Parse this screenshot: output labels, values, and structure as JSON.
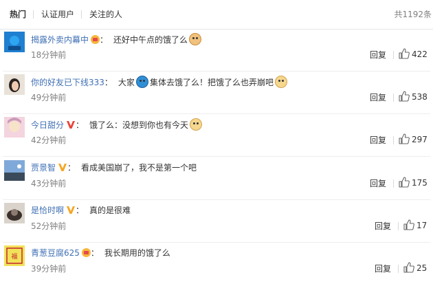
{
  "tabs": [
    {
      "label": "热门",
      "active": true
    },
    {
      "label": "认证用户",
      "active": false
    },
    {
      "label": "关注的人",
      "active": false
    }
  ],
  "total": "共1192条",
  "colors": {
    "username": "#3f6fb5",
    "secondary": "#808080",
    "vip": "#f7b63b"
  },
  "comments": [
    {
      "user": "揭露外卖内幕中",
      "badge": "crown",
      "parts": [
        {
          "t": "还好中午点的饿了么"
        },
        {
          "emoji": "cat-icon"
        }
      ],
      "time": "18分钟前",
      "reply": "回复",
      "likes": "422"
    },
    {
      "user": "你的好友已下线333",
      "badge": "",
      "parts": [
        {
          "t": "大家"
        },
        {
          "emoji": "doraemon-icon"
        },
        {
          "t": "集体去饿了么！把饿了么也弄崩吧"
        },
        {
          "emoji": "doge-icon"
        }
      ],
      "time": "49分钟前",
      "reply": "回复",
      "likes": "538"
    },
    {
      "user": "今日甜分",
      "badge": "v-red",
      "parts": [
        {
          "t": "饿了么：没想到你也有今天"
        },
        {
          "emoji": "doge-icon"
        }
      ],
      "time": "42分钟前",
      "reply": "回复",
      "likes": "297"
    },
    {
      "user": "贾景智",
      "badge": "v-gold",
      "parts": [
        {
          "t": "看成美国崩了，我不是第一个吧"
        }
      ],
      "time": "43分钟前",
      "reply": "回复",
      "likes": "175"
    },
    {
      "user": "是恰时啊",
      "badge": "v-gold",
      "parts": [
        {
          "t": "真的是很难"
        }
      ],
      "time": "52分钟前",
      "reply": "回复",
      "likes": "17"
    },
    {
      "user": "青葱豆腐625",
      "badge": "crown",
      "parts": [
        {
          "t": "我长期用的饿了么"
        }
      ],
      "time": "39分钟前",
      "reply": "回复",
      "likes": "25"
    }
  ]
}
